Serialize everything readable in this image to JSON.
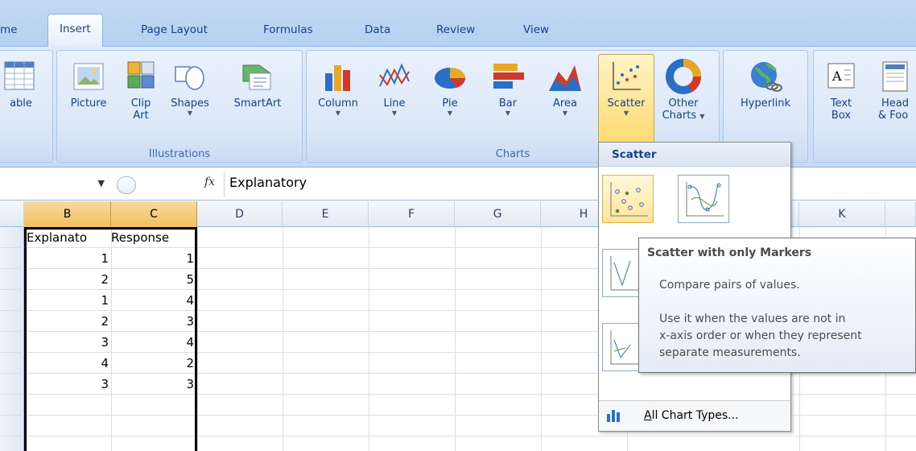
{
  "tabs": [
    "me",
    "Insert",
    "Page Layout",
    "Formulas",
    "Data",
    "Review",
    "View"
  ],
  "active_tab": "Insert",
  "groups": {
    "tables": {
      "buttons": [
        {
          "label": "able"
        }
      ]
    },
    "illustrations": {
      "label": "Illustrations",
      "buttons": [
        {
          "label": "Picture"
        },
        {
          "label": "Clip Art",
          "line1": "Clip",
          "line2": "Art"
        },
        {
          "label": "Shapes"
        },
        {
          "label": "SmartArt"
        }
      ]
    },
    "charts": {
      "label": "Charts",
      "buttons": [
        {
          "label": "Column"
        },
        {
          "label": "Line"
        },
        {
          "label": "Pie"
        },
        {
          "label": "Bar"
        },
        {
          "label": "Area"
        },
        {
          "label": "Scatter"
        },
        {
          "label": "Other Charts",
          "line1": "Other",
          "line2": "Charts"
        }
      ]
    },
    "links": {
      "buttons": [
        {
          "label": "Hyperlink"
        }
      ]
    },
    "text": {
      "buttons": [
        {
          "label": "Text Box",
          "line1": "Text",
          "line2": "Box"
        },
        {
          "label": "Header & Footer",
          "line1": "Head",
          "line2": "& Foo"
        }
      ]
    }
  },
  "formula_bar": {
    "fx_symbol": "fx",
    "content": "Explanatory"
  },
  "columns": [
    "B",
    "C",
    "D",
    "E",
    "F",
    "G",
    "H",
    "K"
  ],
  "selected_columns": [
    "B",
    "C"
  ],
  "sheet": {
    "header_row": [
      "Explanato",
      "Response"
    ],
    "rows": [
      [
        1,
        1
      ],
      [
        2,
        5
      ],
      [
        1,
        4
      ],
      [
        2,
        3
      ],
      [
        3,
        4
      ],
      [
        4,
        2
      ],
      [
        3,
        3
      ]
    ]
  },
  "scatter_menu": {
    "title": "Scatter",
    "footer": "All Chart Types..."
  },
  "tooltip": {
    "title": "Scatter with only Markers",
    "line1": "Compare pairs of values.",
    "line2": "Use it when the values are not in",
    "line3": "x-axis order or when they represent",
    "line4": "separate measurements."
  }
}
